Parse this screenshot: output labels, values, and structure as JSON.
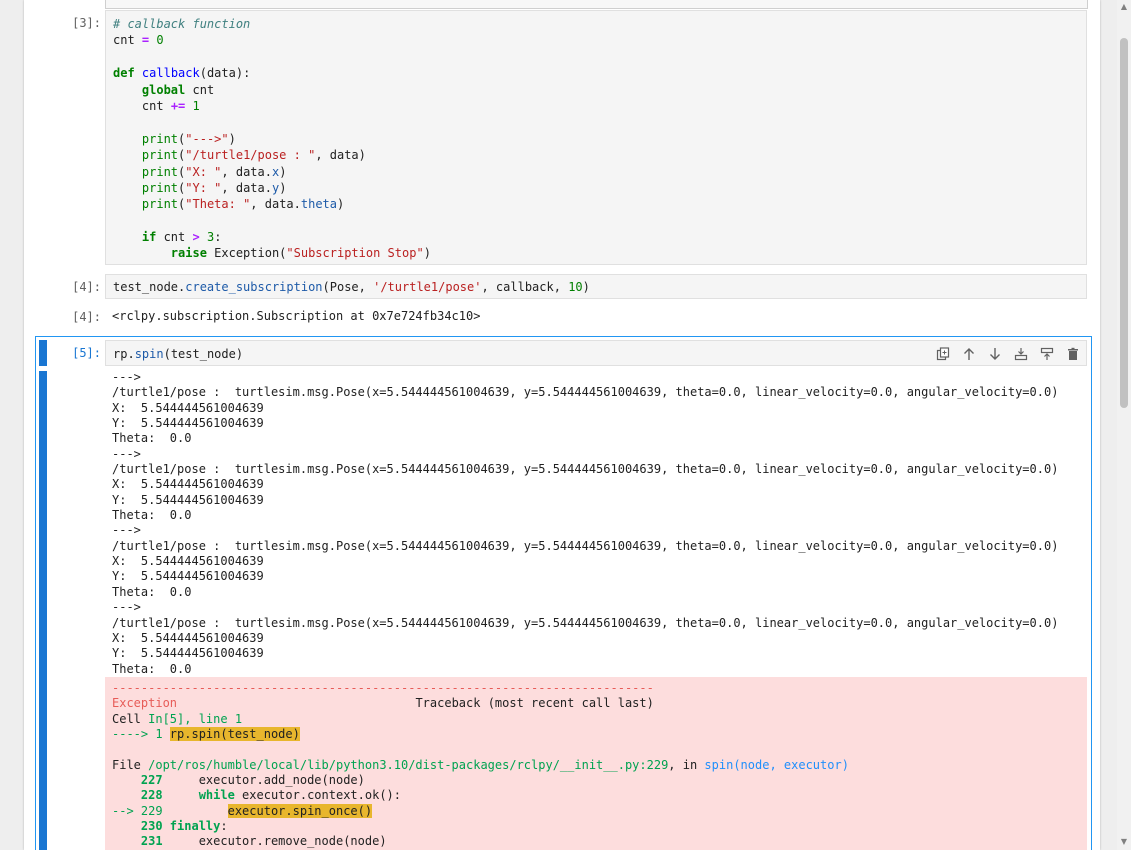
{
  "cells": {
    "cell3": {
      "prompt": "[3]:",
      "code": {
        "l1": "# callback function",
        "l2a": "cnt ",
        "l2b": "=",
        "l2c": "0",
        "l4a": "def",
        "l4b": "callback",
        "l4c": "(data):",
        "l5a": "global",
        "l5b": " cnt",
        "l6a": "cnt ",
        "l6b": "+=",
        "l6c": "1",
        "l8a": "print",
        "l8b": "(",
        "l8c": "\"--->\"",
        "l8d": ")",
        "l9a": "print",
        "l9b": "\"/turtle1/pose : \"",
        "l9c": ", data)",
        "l10a": "print",
        "l10b": "\"X: \"",
        "l10c": ", data.",
        "l10d": "x",
        "l10e": ")",
        "l11a": "print",
        "l11b": "\"Y: \"",
        "l11c": ", data.",
        "l11d": "y",
        "l11e": ")",
        "l12a": "print",
        "l12b": "\"Theta: \"",
        "l12c": ", data.",
        "l12d": "theta",
        "l12e": ")",
        "l14a": "if",
        "l14b": " cnt ",
        "l14c": ">",
        "l14d": "3",
        "l14e": ":",
        "l15a": "raise",
        "l15b": " Exception(",
        "l15c": "\"Subscription Stop\"",
        "l15d": ")"
      }
    },
    "cell4": {
      "prompt": "[4]:",
      "out_prompt": "[4]:",
      "code": {
        "a": "test_node.",
        "b": "create_subscription",
        "c": "(Pose, ",
        "d": "'/turtle1/pose'",
        "e": ", callback, ",
        "f": "10",
        "g": ")"
      },
      "output": "<rclpy.subscription.Subscription at 0x7e724fb34c10>"
    },
    "cell5": {
      "prompt": "[5]:",
      "code": {
        "a": "rp.",
        "b": "spin",
        "c": "(test_node)"
      },
      "stdout": "--->\n/turtle1/pose :  turtlesim.msg.Pose(x=5.544444561004639, y=5.544444561004639, theta=0.0, linear_velocity=0.0, angular_velocity=0.0)\nX:  5.544444561004639\nY:  5.544444561004639\nTheta:  0.0\n--->\n/turtle1/pose :  turtlesim.msg.Pose(x=5.544444561004639, y=5.544444561004639, theta=0.0, linear_velocity=0.0, angular_velocity=0.0)\nX:  5.544444561004639\nY:  5.544444561004639\nTheta:  0.0\n--->\n/turtle1/pose :  turtlesim.msg.Pose(x=5.544444561004639, y=5.544444561004639, theta=0.0, linear_velocity=0.0, angular_velocity=0.0)\nX:  5.544444561004639\nY:  5.544444561004639\nTheta:  0.0\n--->\n/turtle1/pose :  turtlesim.msg.Pose(x=5.544444561004639, y=5.544444561004639, theta=0.0, linear_velocity=0.0, angular_velocity=0.0)\nX:  5.544444561004639\nY:  5.544444561004639\nTheta:  0.0",
      "traceback": {
        "dashes": "---------------------------------------------------------------------------",
        "exception": "Exception",
        "header_right": "                                 Traceback (most recent call last)",
        "cell_word": "Cell ",
        "cell_ref": "In[5], line 1",
        "arrow1": "----> 1 ",
        "hl1": "rp.spin(test_node)",
        "file_word": "File ",
        "file_path": "/opt/ros/humble/local/lib/python3.10/dist-packages/rclpy/__init__.py:229",
        "in_word": ", in ",
        "func": "spin",
        "args": "(node, executor)",
        "ln227": "    227",
        "code227": "     executor.add_node(node)",
        "ln228": "    228",
        "code228a": "     ",
        "code228kw": "while",
        "code228b": " executor.context.ok():",
        "arrow229": "--> 229",
        "code229pad": "         ",
        "hl229": "executor.spin_once()",
        "ln230": "    230",
        "kw230": " finally",
        "code230": ":",
        "ln231": "    231",
        "code231": "     executor.remove_node(node)"
      }
    }
  },
  "toolbar": {
    "icons": [
      "duplicate-icon",
      "move-up-icon",
      "move-down-icon",
      "insert-above-icon",
      "insert-below-icon",
      "delete-icon"
    ]
  },
  "colors": {
    "active_cell": "#1976d2",
    "traceback_bg": "#fddddd",
    "highlight": "#e8b62d"
  }
}
